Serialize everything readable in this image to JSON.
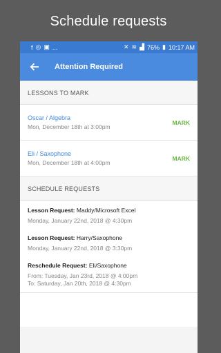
{
  "caption": "Schedule requests",
  "status": {
    "battery": "76%",
    "time": "10:17 AM",
    "dots": "..."
  },
  "appbar": {
    "title": "Attention Required"
  },
  "lessons": {
    "header": "LESSONS TO MARK",
    "items": [
      {
        "name": "Oscar / Algebra",
        "date": "Mon, December 18th at 3:00pm",
        "action": "MARK"
      },
      {
        "name": "Eli / Saxophone",
        "date": "Mon, December 18th at 4:00pm",
        "action": "MARK"
      }
    ]
  },
  "requests": {
    "header": "SCHEDULE REQUESTS",
    "items": [
      {
        "type": "Lesson Request:",
        "who": "Maddy/Microsoft Excel",
        "line1": "Monday, January 22nd, 2018 @  4:30pm",
        "line2": ""
      },
      {
        "type": "Lesson Request:",
        "who": "Harry/Saxophone",
        "line1": "Monday, January 22nd, 2018 @  3:30pm",
        "line2": ""
      },
      {
        "type": "Reschedule Request:",
        "who": "Eli/Saxophone",
        "line1": "From: Tuesday, Jan 23rd, 2018 @  4:00pm",
        "line2": "To: Saturday, Jan 20th, 2018 @  4:30pm"
      }
    ]
  }
}
